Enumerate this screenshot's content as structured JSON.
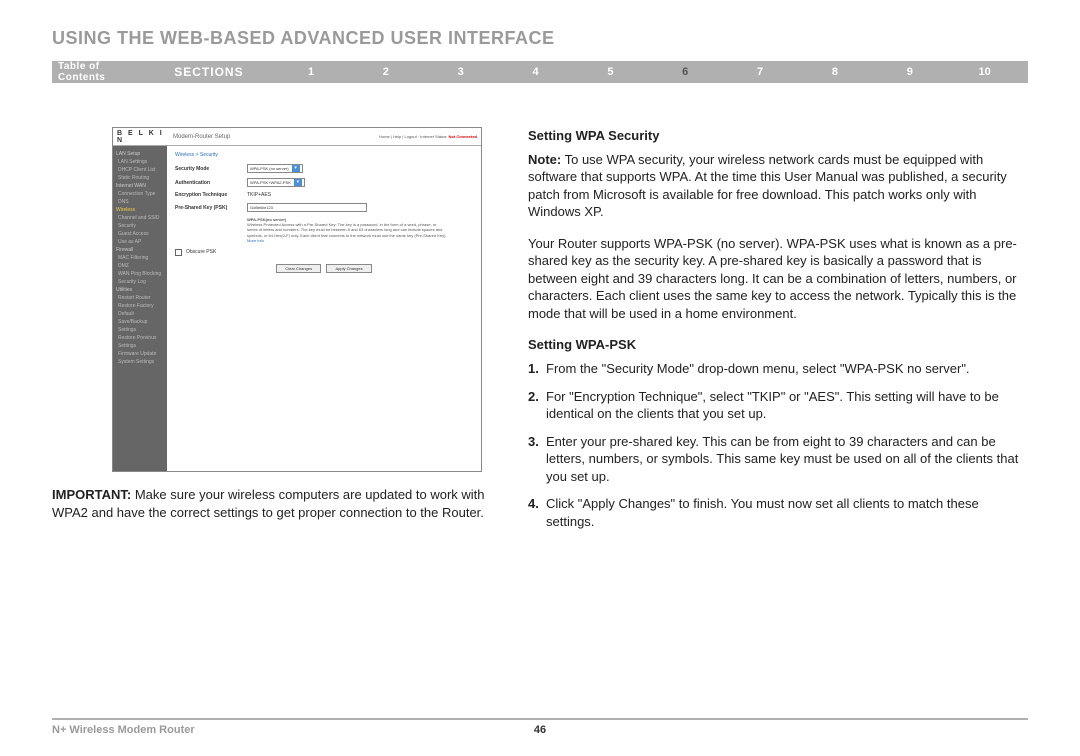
{
  "page_title": "USING THE WEB-BASED ADVANCED USER INTERFACE",
  "nav": {
    "toc": "Table of Contents",
    "sections_label": "SECTIONS",
    "items": [
      "1",
      "2",
      "3",
      "4",
      "5",
      "6",
      "7",
      "8",
      "9",
      "10"
    ],
    "active_index": 5
  },
  "screenshot": {
    "logo": "B E L K I N",
    "window_title": "Modem-Router Setup",
    "header_links": "Home | Help | Logout · Internet Status:",
    "header_status": "Not Connected",
    "breadcrumb": "Wireless > Security",
    "sidebar": [
      {
        "t": "LAN Setup",
        "cls": ""
      },
      {
        "t": "LAN Settings",
        "cls": "sub"
      },
      {
        "t": "DHCP Client List",
        "cls": "sub"
      },
      {
        "t": "Static Routing",
        "cls": "sub"
      },
      {
        "t": "Internet WAN",
        "cls": ""
      },
      {
        "t": "Connection Type",
        "cls": "sub"
      },
      {
        "t": "DNS",
        "cls": "sub"
      },
      {
        "t": "Wireless",
        "cls": "hl"
      },
      {
        "t": "Channel and SSID",
        "cls": "sub hl"
      },
      {
        "t": "Security",
        "cls": "sub"
      },
      {
        "t": "Guest Access",
        "cls": "sub"
      },
      {
        "t": "Use as AP",
        "cls": "sub"
      },
      {
        "t": "Firewall",
        "cls": ""
      },
      {
        "t": "MAC Filtering",
        "cls": "sub"
      },
      {
        "t": "DMZ",
        "cls": "sub"
      },
      {
        "t": "WAN Ping Blocking",
        "cls": "sub"
      },
      {
        "t": "Security Log",
        "cls": "sub"
      },
      {
        "t": "Utilities",
        "cls": ""
      },
      {
        "t": "Restart Router",
        "cls": "sub"
      },
      {
        "t": "Restore Factory Default",
        "cls": "sub"
      },
      {
        "t": "Save/Backup Settings",
        "cls": "sub"
      },
      {
        "t": "Restore Previous Settings",
        "cls": "sub"
      },
      {
        "t": "Firmware Update",
        "cls": "sub"
      },
      {
        "t": "System Settings",
        "cls": "sub"
      }
    ],
    "rows": {
      "security_mode_label": "Security Mode",
      "security_mode_value": "WPA-PSK (no server)",
      "auth_label": "Authentication",
      "auth_value": "WPA-PSK+WPA2-PSK",
      "enc_label": "Encryption Technique",
      "enc_value": "TKIP+AES",
      "psk_label": "Pre-Shared Key (PSK)",
      "psk_value": "GoBelkin123"
    },
    "desc_title": "WPA-PSK(no server)",
    "desc_body": "Wireless Protected Access with a Pre-Shared Key: The key is a password, in the form of a word, phrase, or series of letters and numbers. The key must be between 8 and 63 characters long and can include spaces and symbols, or 64 Hex(0-F) only. Each client that connects to the network must use the same key (Pre-Shared Key).",
    "desc_link": "More Info",
    "obscure_label": "Obscure PSK",
    "btn_clear": "Clear Changes",
    "btn_apply": "Apply Changes"
  },
  "important": {
    "label": "IMPORTANT:",
    "text": " Make sure your wireless computers are updated to work with WPA2 and have the correct settings to get proper connection to the Router."
  },
  "right": {
    "h1": "Setting WPA Security",
    "note_label": "Note:",
    "note_text": " To use WPA security, your wireless network cards must be equipped with software that supports WPA. At the time this User Manual was published, a security patch from Microsoft is available for free download. This patch works only with Windows XP.",
    "para2": "Your Router supports WPA-PSK (no server). WPA-PSK uses what is known as a pre-shared key as the security key. A pre-shared key is basically a password that is between eight and 39 characters long. It can be a combination of letters, numbers, or characters. Each client uses the same key to access the network. Typically this is the mode that will be used in a home environment.",
    "h2": "Setting WPA-PSK",
    "steps": [
      {
        "n": "1.",
        "t": "From the \"Security Mode\" drop-down menu, select \"WPA-PSK no server\"."
      },
      {
        "n": "2.",
        "t": "For \"Encryption Technique\", select \"TKIP\" or \"AES\". This setting will have to be identical on the clients that you set up."
      },
      {
        "n": "3.",
        "t": "Enter your pre-shared key. This can be from eight to 39 characters and can be letters, numbers, or symbols. This same key must be used on all of the clients that you set up."
      },
      {
        "n": "4.",
        "t": "Click \"Apply Changes\" to finish. You must now set all clients to match these settings."
      }
    ]
  },
  "footer": {
    "product": "N+ Wireless Modem Router",
    "page": "46"
  }
}
